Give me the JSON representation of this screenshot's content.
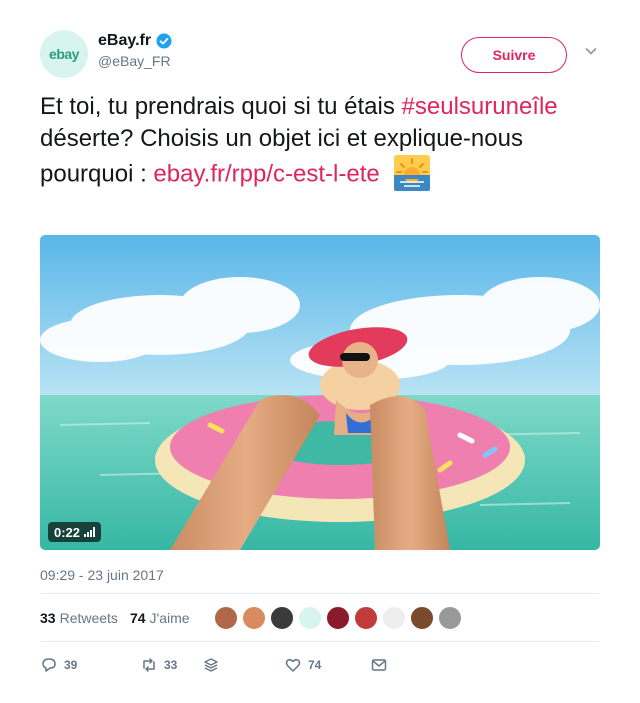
{
  "account": {
    "display_name": "eBay.fr",
    "handle": "@eBay_FR",
    "avatar_text": "ebay",
    "verified_icon": "verified-badge-icon"
  },
  "follow_label": "Suivre",
  "tweet": {
    "line_start": "Et toi, tu prendrais quoi si tu étais",
    "hashtag": "#seulsuruneîle",
    "mid_text": " déserte? Choisis un objet ici et explique-nous pourquoi : ",
    "link": "ebay.fr/rpp/c-est-l-ete",
    "emoji": "sunrise-emoji"
  },
  "media": {
    "duration": "0:22"
  },
  "timestamp": "09:29 - 23 juin 2017",
  "stats": {
    "retweets_count": "33",
    "retweets_label": "Retweets",
    "likes_count": "74",
    "likes_label": "J'aime"
  },
  "actions": {
    "reply_count": "39",
    "retweet_count": "33",
    "like_count": "74"
  },
  "colors": {
    "accent": "#e0245e",
    "muted": "#657786",
    "verified": "#1da1f2"
  }
}
